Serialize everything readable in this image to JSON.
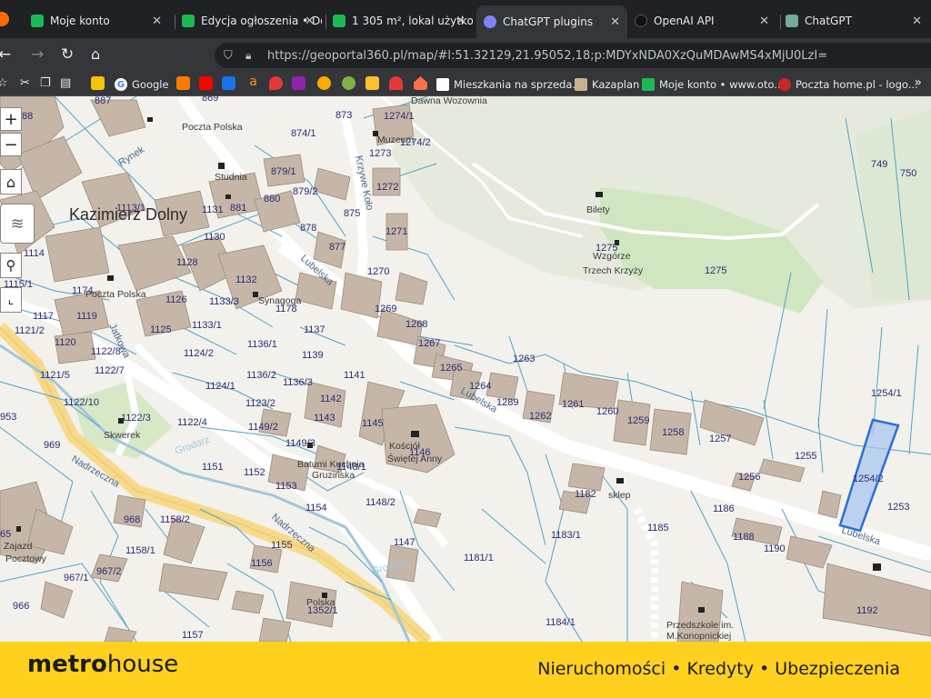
{
  "tabs": [
    {
      "label": "Moje konto",
      "color": "#1db954"
    },
    {
      "label": "Edycja ogłoszenia • Do",
      "color": "#1db954"
    },
    {
      "label": "1 305 m², lokal użytko",
      "color": "#1db954"
    },
    {
      "label": "ChatGPT plugins",
      "color": "#7c83fd"
    },
    {
      "label": "OpenAI API",
      "color": "#111111"
    },
    {
      "label": "ChatGPT",
      "color": "#74aa9c"
    }
  ],
  "address": {
    "url": "https://geoportal360.pl/map/#l:51.32129,21.95052,18;p:MDYxNDA0XzQuMDAwMS4xMjU0LzI="
  },
  "bookmarks": [
    {
      "label": "Google"
    },
    {
      "label": "Mieszkania na sprzeda..."
    },
    {
      "label": "Kazaplan"
    },
    {
      "label": "Moje konto • www.oto..."
    },
    {
      "label": "Poczta home.pl - logo..."
    }
  ],
  "map": {
    "town": "Kazimierz Dolny",
    "streets": [
      "Rynek",
      "Lubelska",
      "Lubelska",
      "Lubelska",
      "Nadrzeczna",
      "Nadrzeczna",
      "Krzywe Koło",
      "Jatkowa",
      "Grodarz",
      "Grodarz"
    ],
    "pois": [
      "Poczta Polska",
      "Studnia",
      "Bilety",
      "Wzgórze",
      "Trzech Krzyży",
      "Skwerek",
      "Kościół",
      "Świętej Anny",
      "sklep",
      "Przedszkole im.",
      "M.Konopnickiej",
      "Batumi Kuchnia",
      "Gruzińska",
      "Synagoga",
      "Muzeum",
      "Polska",
      "Dawna Wozownia",
      "Poczta Polska",
      "Zajazd",
      "Pocztowy"
    ],
    "parcels": [
      "887",
      "869",
      "88",
      "873",
      "874/1",
      "1274/1",
      "1274/2",
      "1273",
      "879/1",
      "879/2",
      "1272",
      "880",
      "881",
      "1131",
      "1113/1",
      "878",
      "875",
      "1271",
      "1130",
      "877",
      "1275",
      "1275",
      "749",
      "750",
      "1114",
      "1128",
      "1270",
      "1132",
      "1115/1",
      "1174",
      "1126",
      "1133/3",
      "1178",
      "1269",
      "1117",
      "1119",
      "1133/1",
      "1137",
      "1268",
      "1121/2",
      "1125",
      "1120",
      "1136/1",
      "1267",
      "1122/8",
      "1124/2",
      "1139",
      "1263",
      "1122/7",
      "1265",
      "1121/5",
      "1124/1",
      "1136/2",
      "1136/3",
      "1141",
      "1264",
      "1289",
      "1261",
      "1254/1",
      "1122/10",
      "1123/2",
      "1142",
      "1262",
      "1260",
      "953",
      "1122/3",
      "1122/4",
      "1143",
      "1145",
      "1259",
      "1258",
      "1149/2",
      "1149/3",
      "1257",
      "969",
      "1146",
      "1255",
      "1151",
      "1152",
      "1148/1",
      "1256",
      "1254/2",
      "1153",
      "1182",
      "1253",
      "1154",
      "1148/2",
      "1186",
      "968",
      "1158/2",
      "1185",
      "1183/1",
      "1188",
      "1190",
      "1158/1",
      "1155",
      "1147",
      "1181/1",
      "967/2",
      "1156",
      "967/1",
      "1352/1",
      "1192",
      "966",
      "1184/1",
      "1157",
      "65"
    ],
    "highlight_parcel": "1254/2"
  },
  "colors": {
    "parcel_line": "#4fa3c7",
    "highlight": "#2a6fdb",
    "footer": "#ffd01d"
  },
  "footer": {
    "logo_pre": "metr",
    "logo_o": "o",
    "logo_post": "house",
    "tagline": "Nieruchomości • Kredyty • Ubezpieczenia"
  }
}
